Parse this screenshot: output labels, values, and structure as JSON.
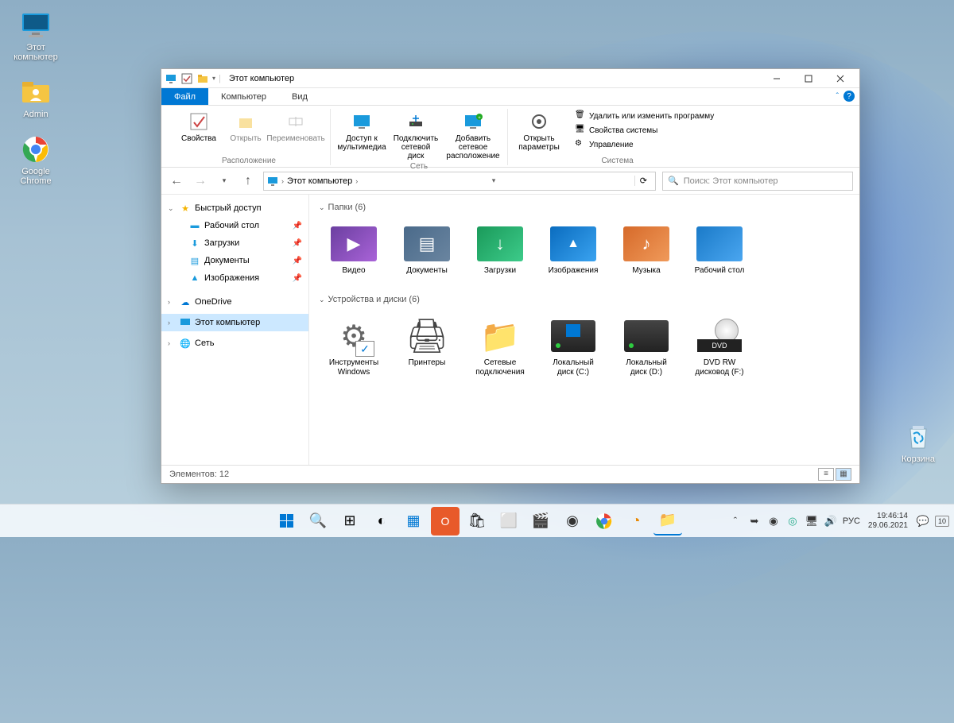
{
  "desktop": {
    "this_pc": "Этот компьютер",
    "admin": "Admin",
    "chrome": "Google Chrome",
    "recycle": "Корзина"
  },
  "window": {
    "title": "Этот компьютер",
    "tabs": {
      "file": "Файл",
      "computer": "Компьютер",
      "view": "Вид"
    },
    "ribbon": {
      "group_location": "Расположение",
      "group_network": "Сеть",
      "group_system": "Система",
      "properties": "Свойства",
      "open": "Открыть",
      "rename": "Переименовать",
      "media_access": "Доступ к мультимедиа",
      "map_drive": "Подключить сетевой диск",
      "add_netloc": "Добавить сетевое расположение",
      "open_settings": "Открыть параметры",
      "uninstall": "Удалить или изменить программу",
      "sys_props": "Свойства системы",
      "manage": "Управление"
    },
    "address": {
      "crumb": "Этот компьютер",
      "search_placeholder": "Поиск: Этот компьютер"
    },
    "nav": {
      "quick": "Быстрый доступ",
      "desktop": "Рабочий стол",
      "downloads": "Загрузки",
      "documents": "Документы",
      "pictures": "Изображения",
      "onedrive": "OneDrive",
      "this_pc": "Этот компьютер",
      "network": "Сеть"
    },
    "sections": {
      "folders": "Папки (6)",
      "devices": "Устройства и диски (6)"
    },
    "folders": {
      "video": "Видео",
      "documents": "Документы",
      "downloads": "Загрузки",
      "pictures": "Изображения",
      "music": "Музыка",
      "desktop": "Рабочий стол"
    },
    "devices": {
      "wintools": "Инструменты Windows",
      "printers": "Принтеры",
      "netconn": "Сетевые подключения",
      "disk_c": "Локальный диск (C:)",
      "disk_d": "Локальный диск (D:)",
      "dvd": "DVD RW дисковод (F:)",
      "dvd_badge": "DVD"
    },
    "status": "Элементов: 12"
  },
  "tray": {
    "lang": "РУС",
    "time": "19:46:14",
    "date": "29.06.2021",
    "notif_count": "10"
  }
}
